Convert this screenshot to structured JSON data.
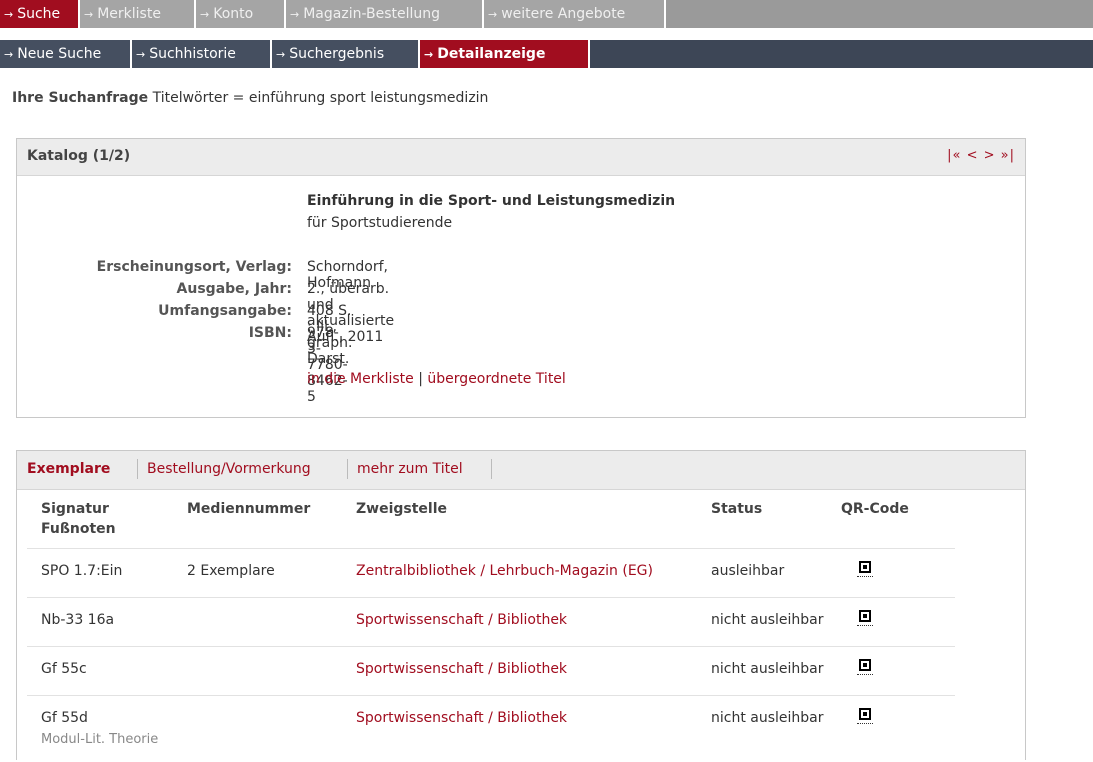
{
  "nav_primary": [
    {
      "label": "Suche",
      "active": true
    },
    {
      "label": "Merkliste",
      "active": false
    },
    {
      "label": "Konto",
      "active": false
    },
    {
      "label": "Magazin-Bestellung",
      "active": false
    },
    {
      "label": "weitere Angebote",
      "active": false
    }
  ],
  "nav_secondary": [
    {
      "label": "Neue Suche",
      "active": false
    },
    {
      "label": "Suchhistorie",
      "active": false
    },
    {
      "label": "Suchergebnis",
      "active": false
    },
    {
      "label": "Detailanzeige",
      "active": true
    }
  ],
  "query": {
    "label": "Ihre Suchanfrage",
    "text": "Titelwörter = einführung sport leistungsmedizin"
  },
  "catalog": {
    "title": "Katalog (1/2)",
    "pager": "|« < > »|",
    "book_title": "Einführung in die Sport- und Leistungsmedizin",
    "subtitle": "für Sportstudierende",
    "fields": [
      {
        "label": "Erscheinungsort, Verlag:",
        "value": "Schorndorf, Hofmann"
      },
      {
        "label": "Ausgabe, Jahr:",
        "value": "2., überarb. und aktualisierte Aufl., 2011"
      },
      {
        "label": "Umfangsangabe:",
        "value": "408 S. : Ill., graph. Darst."
      },
      {
        "label": "ISBN:",
        "value": "978-3-7780-8462-5"
      }
    ],
    "link_merkliste": "in die Merkliste",
    "link_separator": "|",
    "link_parent": "übergeordnete Titel"
  },
  "holdings": {
    "tabs": [
      "Exemplare",
      "Bestellung/Vormerkung",
      "mehr zum Titel"
    ],
    "headers": {
      "signatur": "Signatur",
      "fussnoten": "Fußnoten",
      "mediennummer": "Mediennummer",
      "zweigstelle": "Zweigstelle",
      "status": "Status",
      "qr": "QR-Code"
    },
    "rows": [
      {
        "signatur": "SPO 1.7:Ein",
        "mediennummer": "2 Exemplare",
        "zweigstelle": "Zentralbibliothek / Lehrbuch-Magazin (EG)",
        "status": "ausleihbar",
        "note": ""
      },
      {
        "signatur": "Nb-33 16a",
        "mediennummer": "",
        "zweigstelle": "Sportwissenschaft / Bibliothek",
        "status": "nicht ausleihbar",
        "note": ""
      },
      {
        "signatur": "Gf 55c",
        "mediennummer": "",
        "zweigstelle": "Sportwissenschaft / Bibliothek",
        "status": "nicht ausleihbar",
        "note": ""
      },
      {
        "signatur": "Gf 55d",
        "mediennummer": "",
        "zweigstelle": "Sportwissenschaft / Bibliothek",
        "status": "nicht ausleihbar",
        "note": "Modul-Lit. Theorie"
      }
    ]
  },
  "colors": {
    "accent": "#a10d1f",
    "nav_primary_bg": "#a5a5a5",
    "nav_secondary_bg": "#454f60"
  }
}
